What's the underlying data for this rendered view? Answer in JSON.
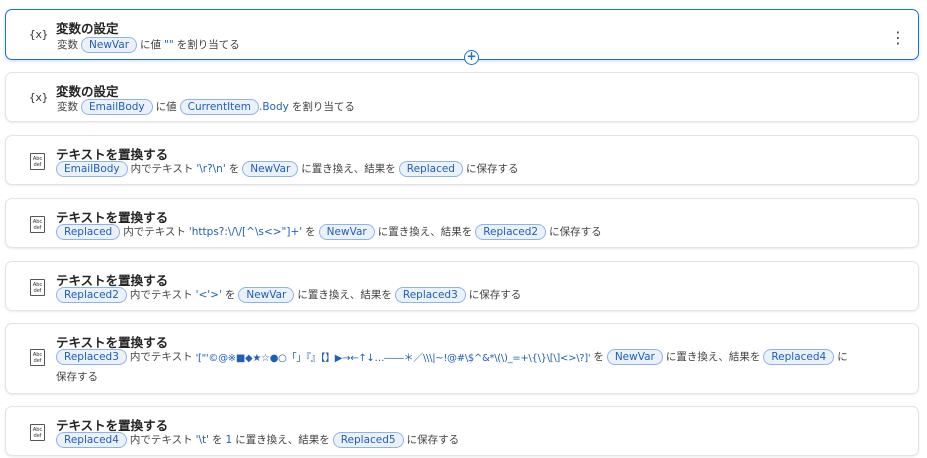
{
  "steps": [
    {
      "icon": "variable-icon",
      "icon_text": "{x}",
      "title": "変数の設定",
      "parts": [
        "変数",
        "NewVar",
        "に値",
        "\"\"",
        "を割り当てる"
      ]
    },
    {
      "icon": "variable-icon",
      "icon_text": "{x}",
      "title": "変数の設定",
      "parts": [
        "変数",
        "EmailBody",
        "に値",
        "CurrentItem",
        ".Body",
        "を割り当てる"
      ]
    },
    {
      "icon": "text-replace-icon",
      "icon_text": "Abc def",
      "title": "テキストを置換する",
      "parts": [
        "EmailBody",
        "内でテキスト",
        "'\\r?\\n'",
        "を",
        "NewVar",
        "に置き換え、結果を",
        "Replaced",
        "に保存する"
      ]
    },
    {
      "icon": "text-replace-icon",
      "icon_text": "Abc def",
      "title": "テキストを置換する",
      "parts": [
        "Replaced",
        "内でテキスト",
        "'https?:\\/\\/[^\\s<>\"]+'",
        "を",
        "NewVar",
        "に置き換え、結果を",
        "Replaced2",
        "に保存する"
      ]
    },
    {
      "icon": "text-replace-icon",
      "icon_text": "Abc def",
      "title": "テキストを置換する",
      "parts": [
        "Replaced2",
        "内でテキスト",
        "'<'>'",
        "を",
        "NewVar",
        "に置き換え、結果を",
        "Replaced3",
        "に保存する"
      ]
    },
    {
      "icon": "text-replace-icon",
      "icon_text": "Abc def",
      "title": "テキストを置換する",
      "parts": [
        "Replaced3",
        "内でテキスト",
        "'[\"'©@※■◆★☆●○「」『』【】▶→←↑↓…――＊／\\\\\\|~!@#\\$^&*\\(\\)_=+\\{\\}\\[\\]<>\\?]'",
        "を",
        "NewVar",
        "に置き換え、結果を",
        "Replaced4",
        "に",
        "保存する"
      ]
    },
    {
      "icon": "text-replace-icon",
      "icon_text": "Abc def",
      "title": "テキストを置換する",
      "parts": [
        "Replaced4",
        "内でテキスト",
        "'\\t'",
        "を",
        "1",
        "に置き換え、結果を",
        "Replaced5",
        "に保存する"
      ]
    }
  ],
  "more_options_glyph": "⋮",
  "add_glyph": "+"
}
